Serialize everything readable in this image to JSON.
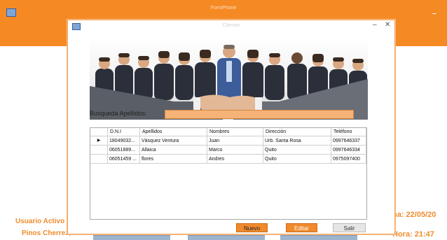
{
  "colors": {
    "accent": "#f58a25",
    "search_field": "#f5b377",
    "button": "#f08a2c"
  },
  "main_window": {
    "title": "FormPhone",
    "status": {
      "user_label": "Usuario Activo",
      "user_name": "Pinos Cherrez,",
      "date_text": "na: 22/05/20",
      "time_text": "Hora: 21:47"
    }
  },
  "dialog": {
    "title": "Clientes",
    "icons": {
      "minimize": "minimize-icon",
      "close": "close-icon",
      "app": "app-icon"
    },
    "banner_image": "business-handshake-team",
    "search": {
      "label": "Busqueda  Apellidos:",
      "value": ""
    },
    "table": {
      "columns": [
        "D.N.I",
        "Apellidos",
        "Nombres",
        "Dirección",
        "Teléfono"
      ],
      "rows": [
        {
          "selected": true,
          "dni": "18049032...",
          "apellidos": "Vásquez Ventura",
          "nombres": "Juan",
          "direccion": "Urb. Santa Rosa",
          "telefono": "0997646337"
        },
        {
          "selected": false,
          "dni": "06051889...",
          "apellidos": "Allaica",
          "nombres": "Marco",
          "direccion": "Quito",
          "telefono": "0997646334"
        },
        {
          "selected": false,
          "dni": "06051459 ...",
          "apellidos": "flores",
          "nombres": "Andres",
          "direccion": "Quito",
          "telefono": "0975097400"
        }
      ]
    },
    "buttons": {
      "nuevo": "Nuevo",
      "editar": "Editar",
      "salir": "Salir"
    }
  }
}
